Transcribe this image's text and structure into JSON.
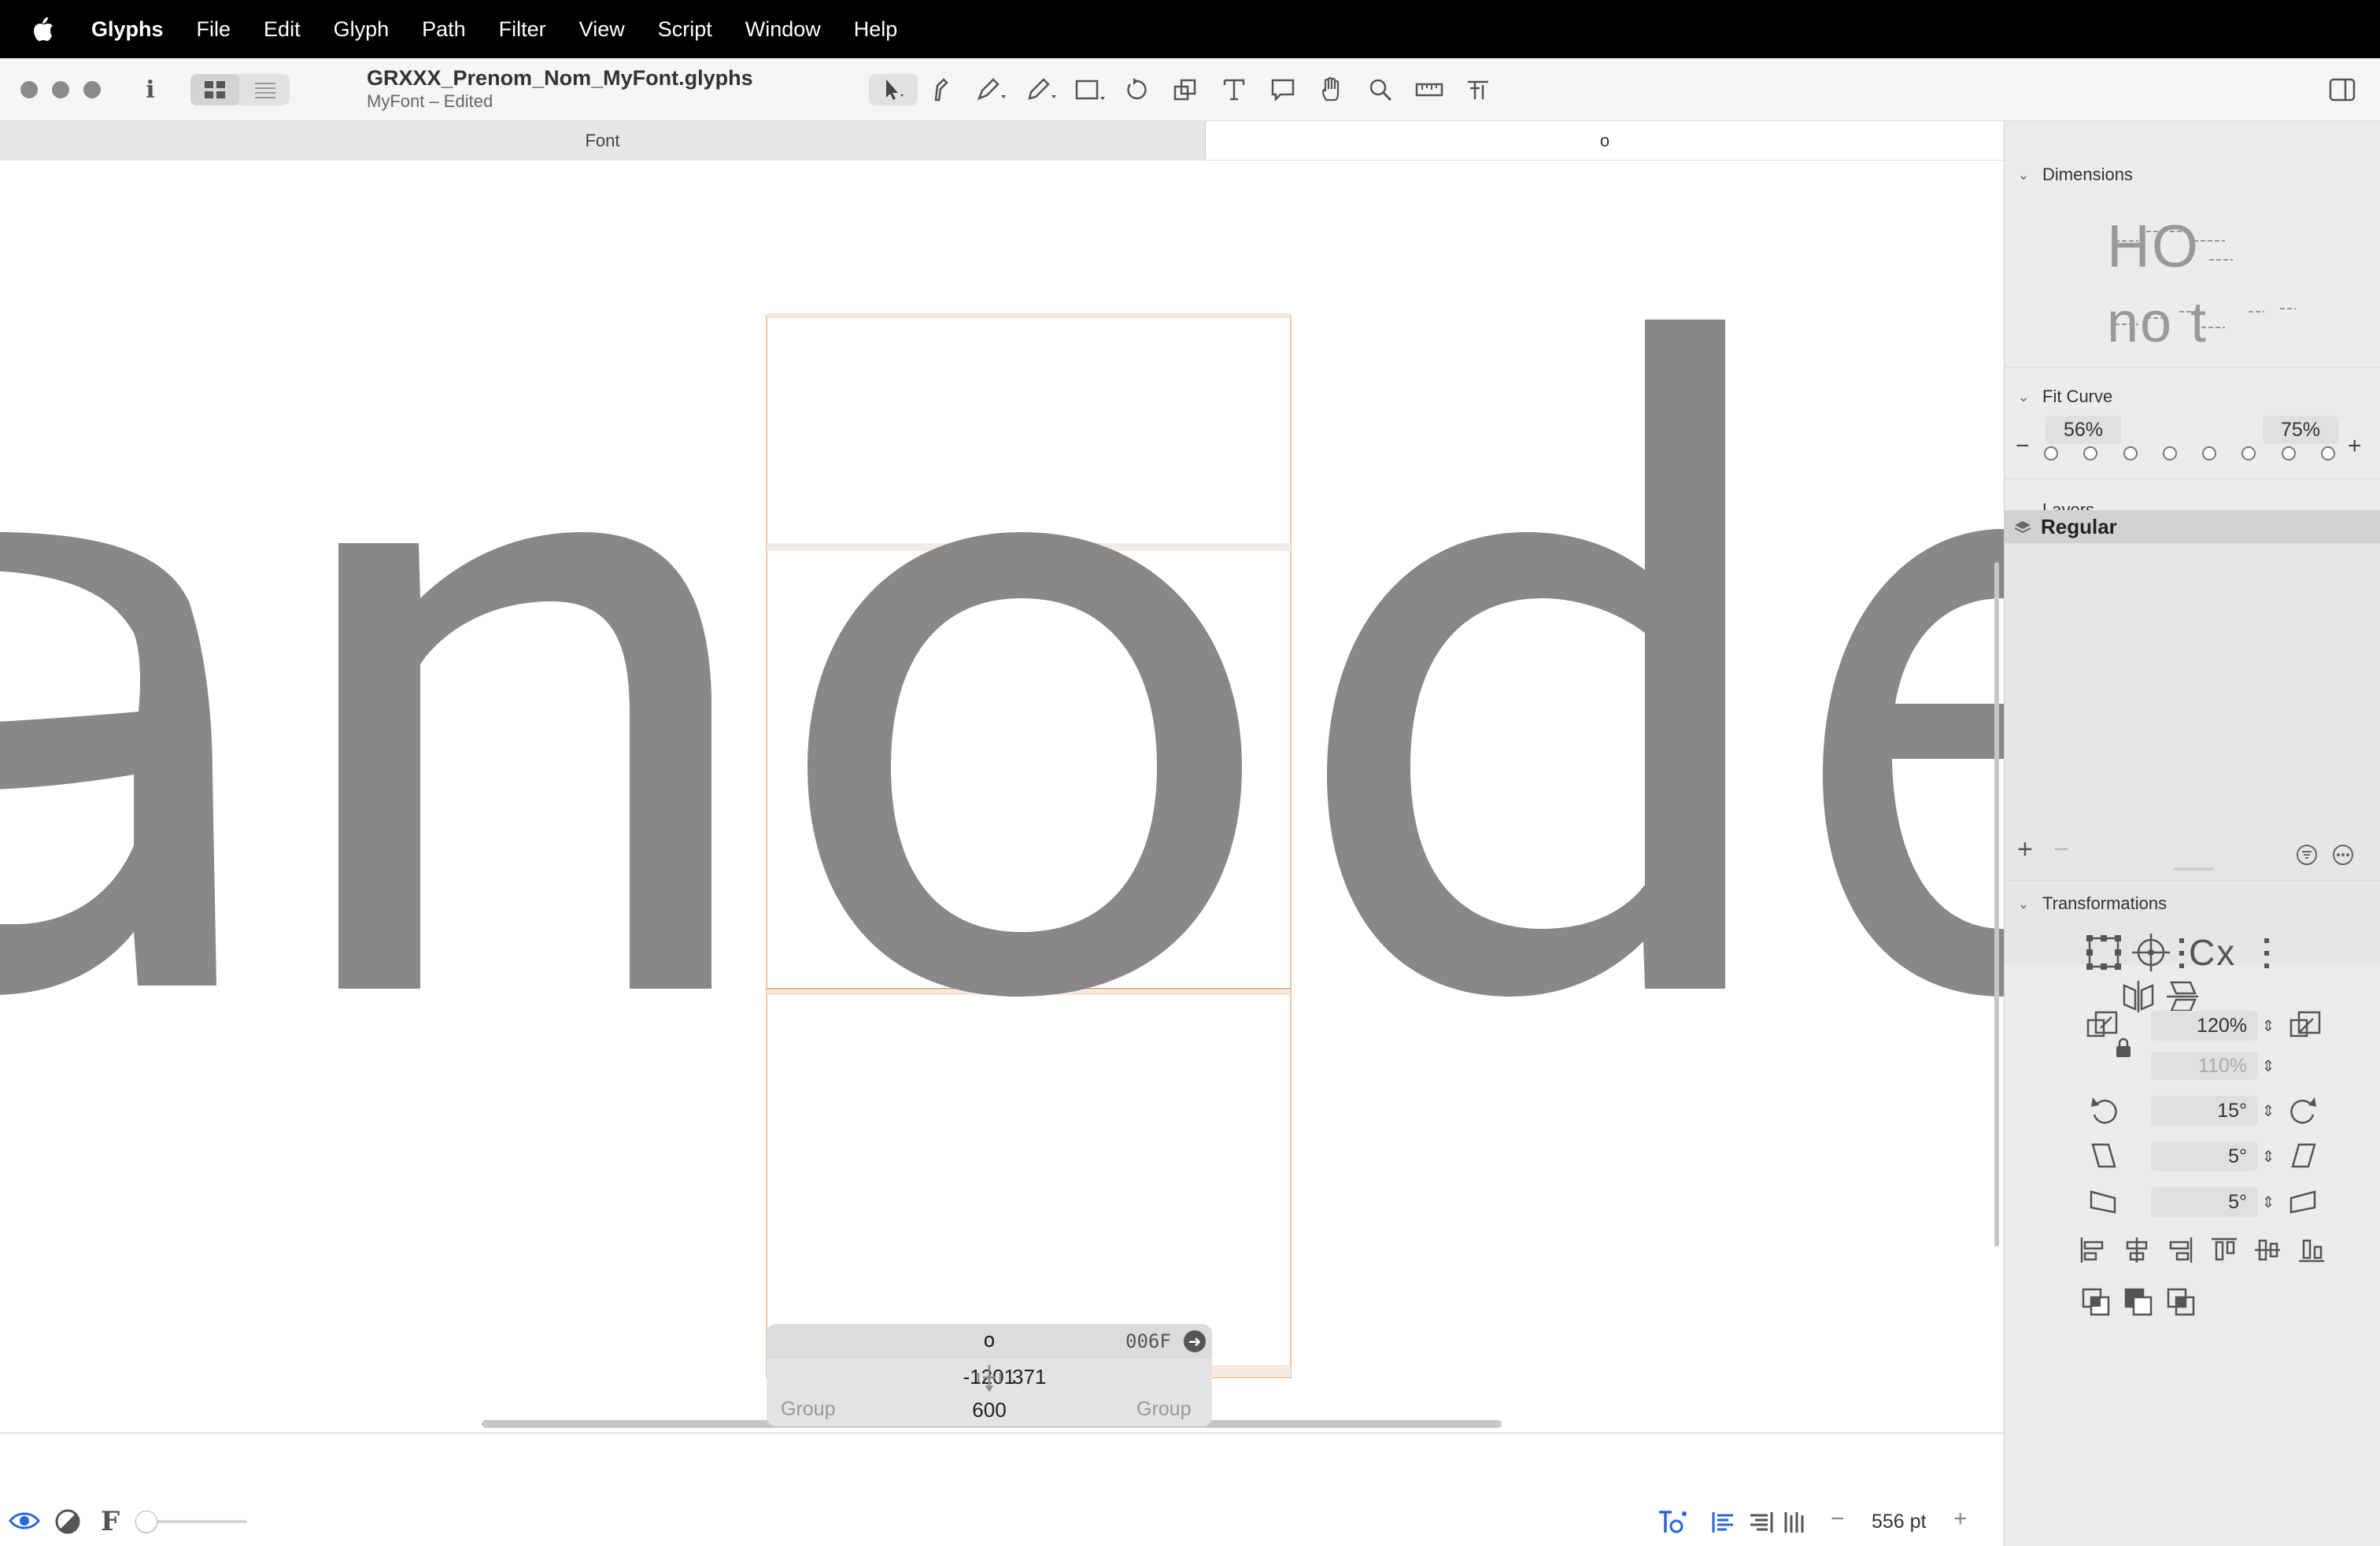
{
  "menubar": {
    "app": "Glyphs",
    "items": [
      "File",
      "Edit",
      "Glyph",
      "Path",
      "Filter",
      "View",
      "Script",
      "Window",
      "Help"
    ]
  },
  "toolbar": {
    "title": "GRXXX_Prenom_Nom_MyFont.glyphs",
    "subtitle": "MyFont – Edited"
  },
  "tabs": {
    "font": "Font",
    "edit": "o"
  },
  "canvas": {
    "text": "anode",
    "active_glyph": "o"
  },
  "infobox": {
    "glyph_name": "o",
    "unicode": "006F",
    "lsb": "-1201",
    "rsb": "371",
    "width": "600",
    "left_group": "Group",
    "right_group": "Group"
  },
  "bottombar": {
    "font_size": "556 pt",
    "minus": "−",
    "plus": "+"
  },
  "sidebar": {
    "dimensions": {
      "label": "Dimensions",
      "preview_top": "HO",
      "preview_bottom": "no t"
    },
    "fit_curve": {
      "label": "Fit Curve",
      "min": "56%",
      "max": "75%",
      "minus": "−",
      "plus": "+"
    },
    "layers": {
      "label": "Layers",
      "items": [
        "Regular"
      ],
      "add": "+",
      "remove": "−"
    },
    "transformations": {
      "label": "Transformations",
      "scale_x": "120%",
      "scale_y": "110%",
      "rotate": "15°",
      "slant_1": "5°",
      "slant_2": "5°"
    }
  },
  "colors": {
    "glyph_fill": "#888888",
    "metric_line": "#e8b48a",
    "menubar_bg": "#000000",
    "sidebar_bg": "#ececec",
    "selected_layer_bg": "#d2d2d2"
  }
}
